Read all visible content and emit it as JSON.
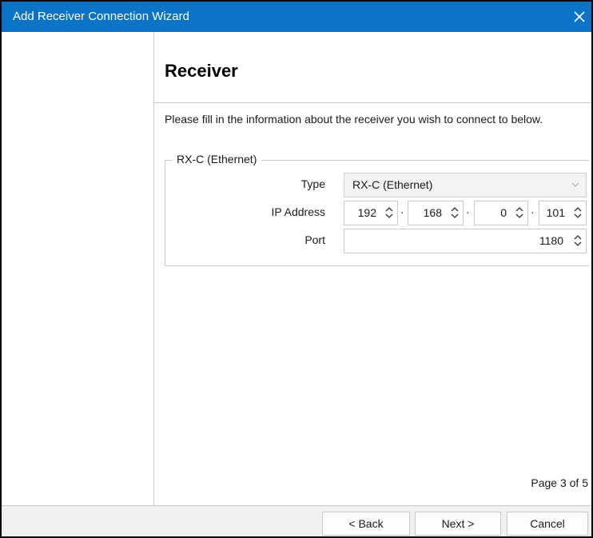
{
  "window": {
    "title": "Add Receiver Connection Wizard",
    "titlebar_color": "#0b74c7",
    "close_icon": "close-icon"
  },
  "page": {
    "heading": "Receiver",
    "instructions": "Please fill in the information about the receiver you wish to connect to below.",
    "page_indicator": "Page 3 of 5"
  },
  "group": {
    "legend": "RX-C (Ethernet)",
    "type_label": "Type",
    "type_value": "RX-C (Ethernet)",
    "ip_label": "IP Address",
    "ip": [
      "192",
      "168",
      "0",
      "101"
    ],
    "ip_separator": "·",
    "port_label": "Port",
    "port_value": "1180"
  },
  "buttons": {
    "back": "< Back",
    "next": "Next >",
    "cancel": "Cancel"
  }
}
